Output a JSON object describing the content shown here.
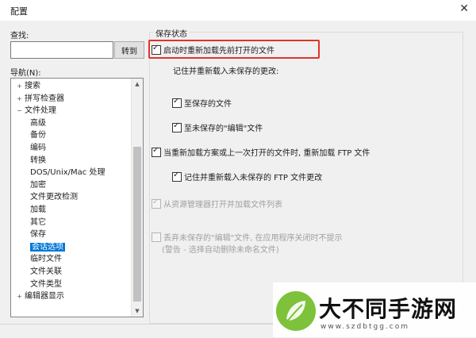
{
  "window": {
    "title": "配置",
    "close_glyph": "✕"
  },
  "search": {
    "label": "查找:",
    "value": "",
    "goto_label": "转到"
  },
  "nav": {
    "label": "导航(N):",
    "items": [
      {
        "label": "搜索",
        "expander": "+"
      },
      {
        "label": "拼写检查器",
        "expander": "+"
      },
      {
        "label": "文件处理",
        "expander": "−"
      },
      {
        "label": "高级",
        "expander": ""
      },
      {
        "label": "备份",
        "expander": ""
      },
      {
        "label": "编码",
        "expander": ""
      },
      {
        "label": "转换",
        "expander": ""
      },
      {
        "label": "DOS/Unix/Mac 处理",
        "expander": ""
      },
      {
        "label": "加密",
        "expander": ""
      },
      {
        "label": "文件更改检测",
        "expander": ""
      },
      {
        "label": "加载",
        "expander": ""
      },
      {
        "label": "其它",
        "expander": ""
      },
      {
        "label": "保存",
        "expander": ""
      },
      {
        "label": "会话选项",
        "expander": "",
        "selected": true
      },
      {
        "label": "临时文件",
        "expander": ""
      },
      {
        "label": "文件关联",
        "expander": ""
      },
      {
        "label": "文件类型",
        "expander": ""
      },
      {
        "label": "编辑器显示",
        "expander": "+"
      }
    ],
    "scroll_up": "▲",
    "scroll_down": "▼"
  },
  "options": {
    "group_title": "保存状态",
    "reopen_label": "启动时重新加载先前打开的文件",
    "remember_heading": "记住并重新载入未保存的更改:",
    "to_saved_label": "至保存的文件",
    "to_unsaved_label": "至未保存的\"编辑\"文件",
    "ftp_reload_label": "当重新加载方案或上一次打开的文件时, 重新加载 FTP 文件",
    "ftp_remember_label": "记住并重新载入未保存的 FTP 文件更改",
    "explorer_label": "从资源管理器打开并加载文件列表",
    "discard_label": "丢弃未保存的\"编辑\"文件, 在应用程序关闭时不提示",
    "discard_note": "(警告 - 选择自动删除未命名文件)"
  },
  "watermark": {
    "title": "大不同手游网",
    "url": "www.szdbtgg.com"
  },
  "colors": {
    "highlight": "#e0332a",
    "selection": "#0078d7",
    "logo_green": "#7dc23a"
  }
}
